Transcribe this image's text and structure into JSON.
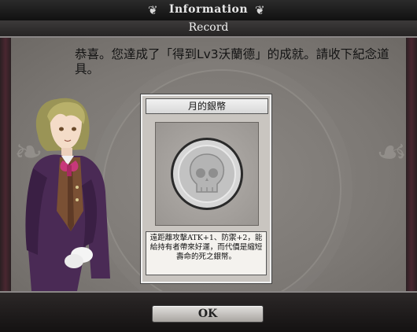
{
  "header": {
    "title": "Information",
    "left_ornament": "❦",
    "right_ornament": "❦"
  },
  "subheader": {
    "title": "Record"
  },
  "message": "恭喜。您達成了「得到Lv3沃蘭德」的成就。請收下紀念道具。",
  "item_card": {
    "name": "月的銀幣",
    "description": "遠距離攻擊ATK+1、防禦+2，能給持有者帶來好運，而代價是縮短壽命的死之銀幣。",
    "art_icon": "skull-coin-icon"
  },
  "footer": {
    "ok_label": "OK"
  },
  "colors": {
    "background": "#7c7874",
    "header": "#1a1a1a",
    "coin": "#cfcfcf",
    "coat": "#4a2a55"
  }
}
